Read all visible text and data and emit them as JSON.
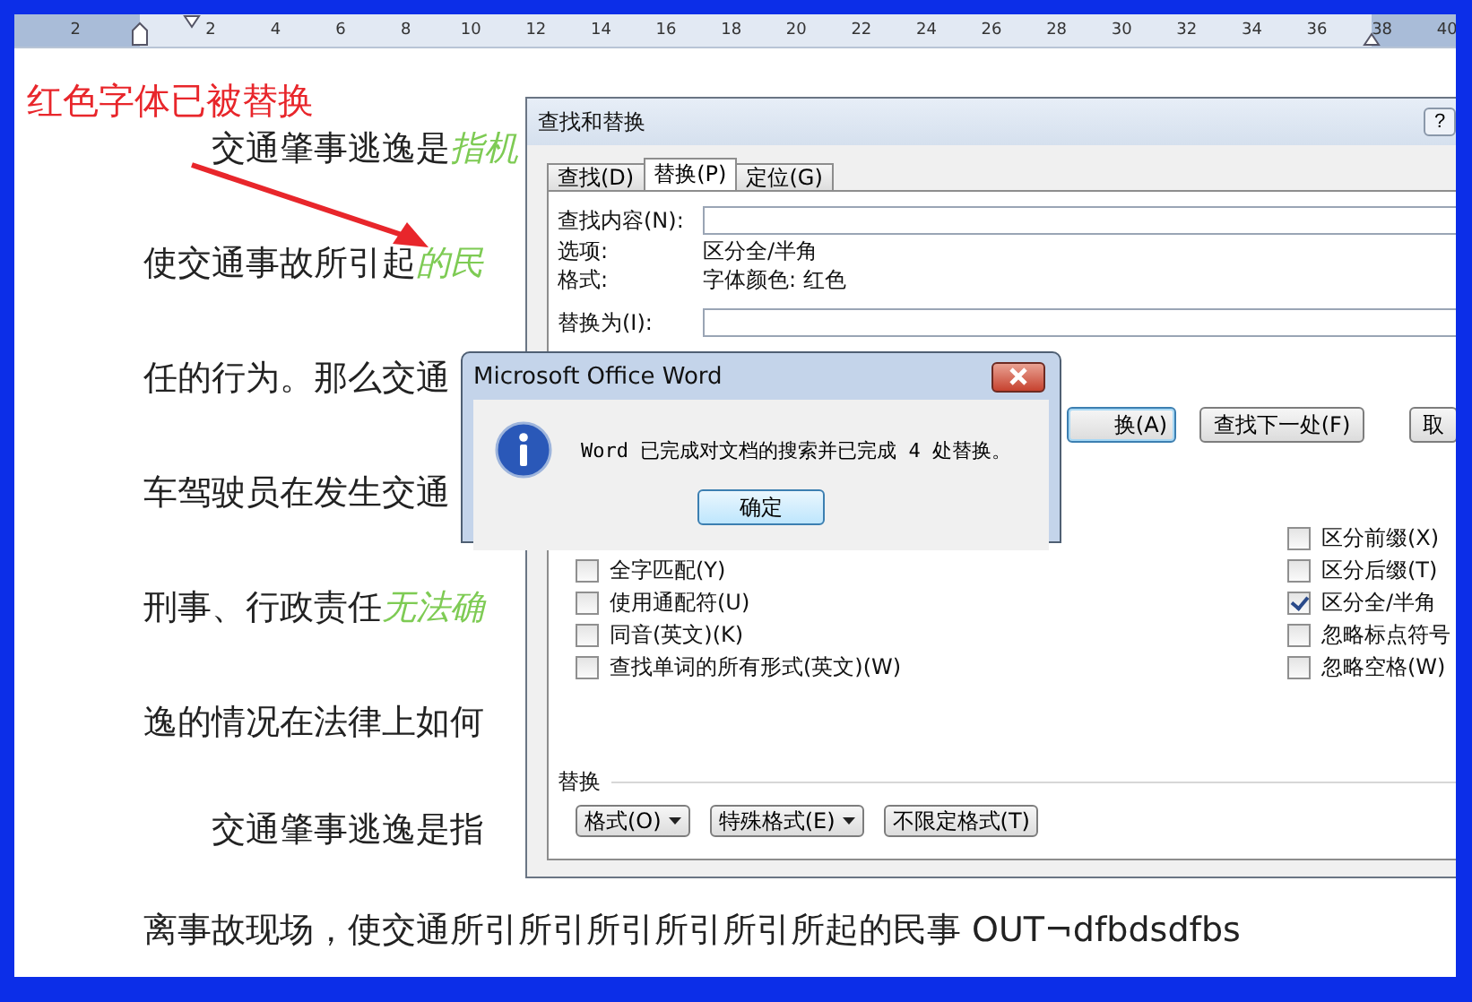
{
  "ruler": {
    "marks": [
      "2",
      "2",
      "4",
      "6",
      "8",
      "10",
      "12",
      "14",
      "16",
      "18",
      "20",
      "22",
      "24",
      "26",
      "28",
      "30",
      "32",
      "34",
      "36",
      "38",
      "40"
    ]
  },
  "annotation": {
    "text": "红色字体已被替换"
  },
  "document": {
    "lines": [
      {
        "segments": [
          {
            "text": "　　交通肇事逃逸是",
            "replaced": false
          },
          {
            "text": "指机",
            "replaced": true
          }
        ]
      },
      {
        "segments": [
          {
            "text": "使交通事故所引起",
            "replaced": false
          },
          {
            "text": "的民",
            "replaced": true
          }
        ]
      },
      {
        "segments": [
          {
            "text": "任的行为。那么交通",
            "replaced": false
          }
        ]
      },
      {
        "segments": [
          {
            "text": "车驾驶员在发生交通",
            "replaced": false
          }
        ]
      },
      {
        "segments": [
          {
            "text": "刑事、行政责任",
            "replaced": false
          },
          {
            "text": "无法确",
            "replaced": true
          }
        ]
      },
      {
        "segments": [
          {
            "text": "逸的情况在法律上如何",
            "replaced": false
          }
        ]
      },
      {
        "segments": [
          {
            "text": "　　交通肇事逃逸是指",
            "replaced": false
          }
        ]
      },
      {
        "segments": [
          {
            "text": "离事故现场，使交通所引所引所引所引所引所起的民事 OUT¬dfbdsdfbs",
            "replaced": false
          }
        ]
      }
    ]
  },
  "find_replace_dialog": {
    "title": "查找和替换",
    "help_button": "?",
    "tabs": [
      {
        "label": "查找(D)",
        "selected": false
      },
      {
        "label": "替换(P)",
        "selected": true
      },
      {
        "label": "定位(G)",
        "selected": false
      }
    ],
    "find_label": "查找内容(N):",
    "options_label": "选项:",
    "options_value": "区分全/半角",
    "format_label": "格式:",
    "format_value": "字体颜色: 红色",
    "replace_label": "替换为(I):",
    "action_buttons": [
      {
        "label": "换(A)",
        "default": true
      },
      {
        "label": "查找下一处(F)",
        "default": false
      },
      {
        "label": "取",
        "default": false
      }
    ],
    "left_options": [
      {
        "label": "全字匹配(Y)",
        "checked": false
      },
      {
        "label": "使用通配符(U)",
        "checked": false
      },
      {
        "label": "同音(英文)(K)",
        "checked": false
      },
      {
        "label": "查找单词的所有形式(英文)(W)",
        "checked": false
      }
    ],
    "right_options": [
      {
        "label": "区分前缀(X)",
        "checked": false
      },
      {
        "label": "区分后缀(T)",
        "checked": false
      },
      {
        "label": "区分全/半角",
        "checked": true
      },
      {
        "label": "忽略标点符号",
        "checked": false
      },
      {
        "label": "忽略空格(W)",
        "checked": false
      }
    ],
    "replace_section": {
      "title": "替换",
      "buttons": [
        {
          "label": "格式(O)",
          "dropdown": true
        },
        {
          "label": "特殊格式(E)",
          "dropdown": true
        },
        {
          "label": "不限定格式(T)",
          "dropdown": false
        }
      ]
    }
  },
  "message_box": {
    "title": "Microsoft Office Word",
    "message": "Word 已完成对文档的搜索并已完成 4 处替换。",
    "ok_button": "确定"
  }
}
